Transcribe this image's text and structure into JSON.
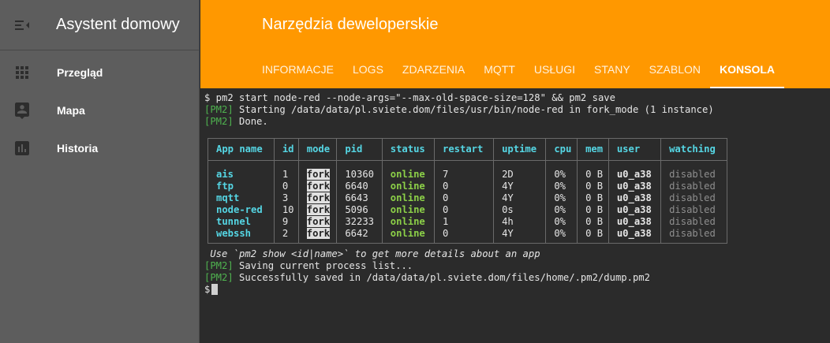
{
  "sidebar": {
    "title": "Asystent domowy",
    "items": [
      {
        "label": "Przegląd",
        "icon": "grid-icon"
      },
      {
        "label": "Mapa",
        "icon": "map-account-icon"
      },
      {
        "label": "Historia",
        "icon": "chart-icon"
      }
    ]
  },
  "header": {
    "title": "Narzędzia deweloperskie",
    "tabs": [
      {
        "label": "INFORMACJE"
      },
      {
        "label": "LOGS"
      },
      {
        "label": "ZDARZENIA"
      },
      {
        "label": "MQTT"
      },
      {
        "label": "USŁUGI"
      },
      {
        "label": "STANY"
      },
      {
        "label": "SZABLON"
      },
      {
        "label": "KONSOLA"
      }
    ],
    "active_tab": "KONSOLA"
  },
  "console": {
    "command": "$ pm2 start node-red --node-args=\"--max-old-space-size=128\" && pm2 save",
    "pm2_tag": "[PM2]",
    "line_starting": " Starting /data/data/pl.sviete.dom/files/usr/bin/node-red in fork_mode (1 instance)",
    "line_done": " Done.",
    "table": {
      "headers": [
        "App name",
        "id",
        "mode",
        "pid",
        "status",
        "restart",
        "uptime",
        "cpu",
        "mem",
        "user",
        "watching"
      ],
      "rows": [
        [
          "ais",
          "1",
          "fork",
          "10360",
          "online",
          "7",
          "2D",
          "0%",
          "0 B",
          "u0_a38",
          "disabled"
        ],
        [
          "ftp",
          "0",
          "fork",
          "6640",
          "online",
          "0",
          "4Y",
          "0%",
          "0 B",
          "u0_a38",
          "disabled"
        ],
        [
          "mqtt",
          "3",
          "fork",
          "6643",
          "online",
          "0",
          "4Y",
          "0%",
          "0 B",
          "u0_a38",
          "disabled"
        ],
        [
          "node-red",
          "10",
          "fork",
          "5096",
          "online",
          "0",
          "0s",
          "0%",
          "0 B",
          "u0_a38",
          "disabled"
        ],
        [
          "tunnel",
          "9",
          "fork",
          "32233",
          "online",
          "1",
          "4h",
          "0%",
          "0 B",
          "u0_a38",
          "disabled"
        ],
        [
          "webssh",
          "2",
          "fork",
          "6642",
          "online",
          "0",
          "4Y",
          "0%",
          "0 B",
          "u0_a38",
          "disabled"
        ]
      ]
    },
    "hint": " Use `pm2 show <id|name>` to get more details about an app",
    "line_saving": " Saving current process list...",
    "line_saved": " Successfully saved in /data/data/pl.sviete.dom/files/home/.pm2/dump.pm2",
    "prompt": "$"
  },
  "colors": {
    "accent": "#ff9800",
    "sidebar": "#5d5d5d",
    "console_bg": "#2b2b2b",
    "cyan": "#55d6e4",
    "online_green": "#8cd048",
    "pm2_green": "#4fb24f"
  }
}
